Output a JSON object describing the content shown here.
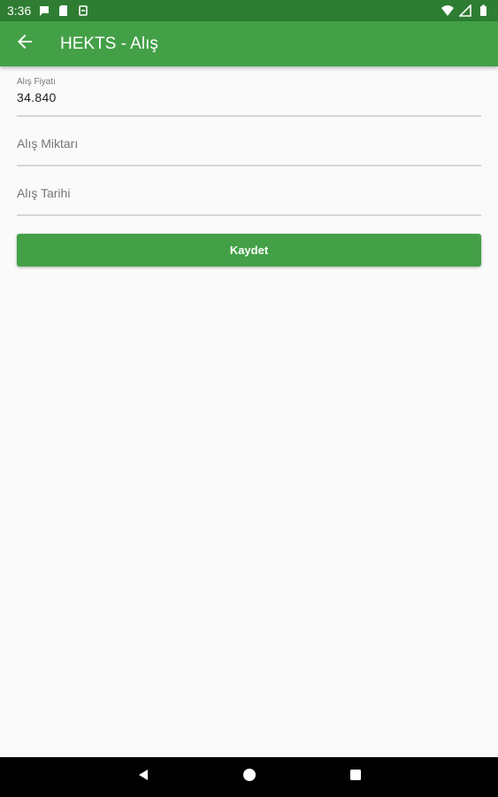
{
  "status_bar": {
    "time": "3:36",
    "left_icons": [
      "chat-bubble-icon",
      "sd-card-icon",
      "sync-icon"
    ],
    "right_icons": [
      "wifi-icon",
      "signal-icon",
      "battery-icon"
    ]
  },
  "app_bar": {
    "title": "HEKTS - Alış",
    "back_icon": "arrow-back-icon"
  },
  "form": {
    "price": {
      "label": "Alış Fiyatı",
      "value": "34.840"
    },
    "quantity": {
      "placeholder": "Alış Miktarı"
    },
    "date": {
      "placeholder": "Alış Tarihi"
    }
  },
  "actions": {
    "save_label": "Kaydet"
  },
  "nav_bar": {
    "icons": [
      "nav-back-icon",
      "nav-home-icon",
      "nav-recents-icon"
    ]
  },
  "colors": {
    "primary": "#43a047",
    "primary_dark": "#2e7d32",
    "background": "#fafafa"
  }
}
